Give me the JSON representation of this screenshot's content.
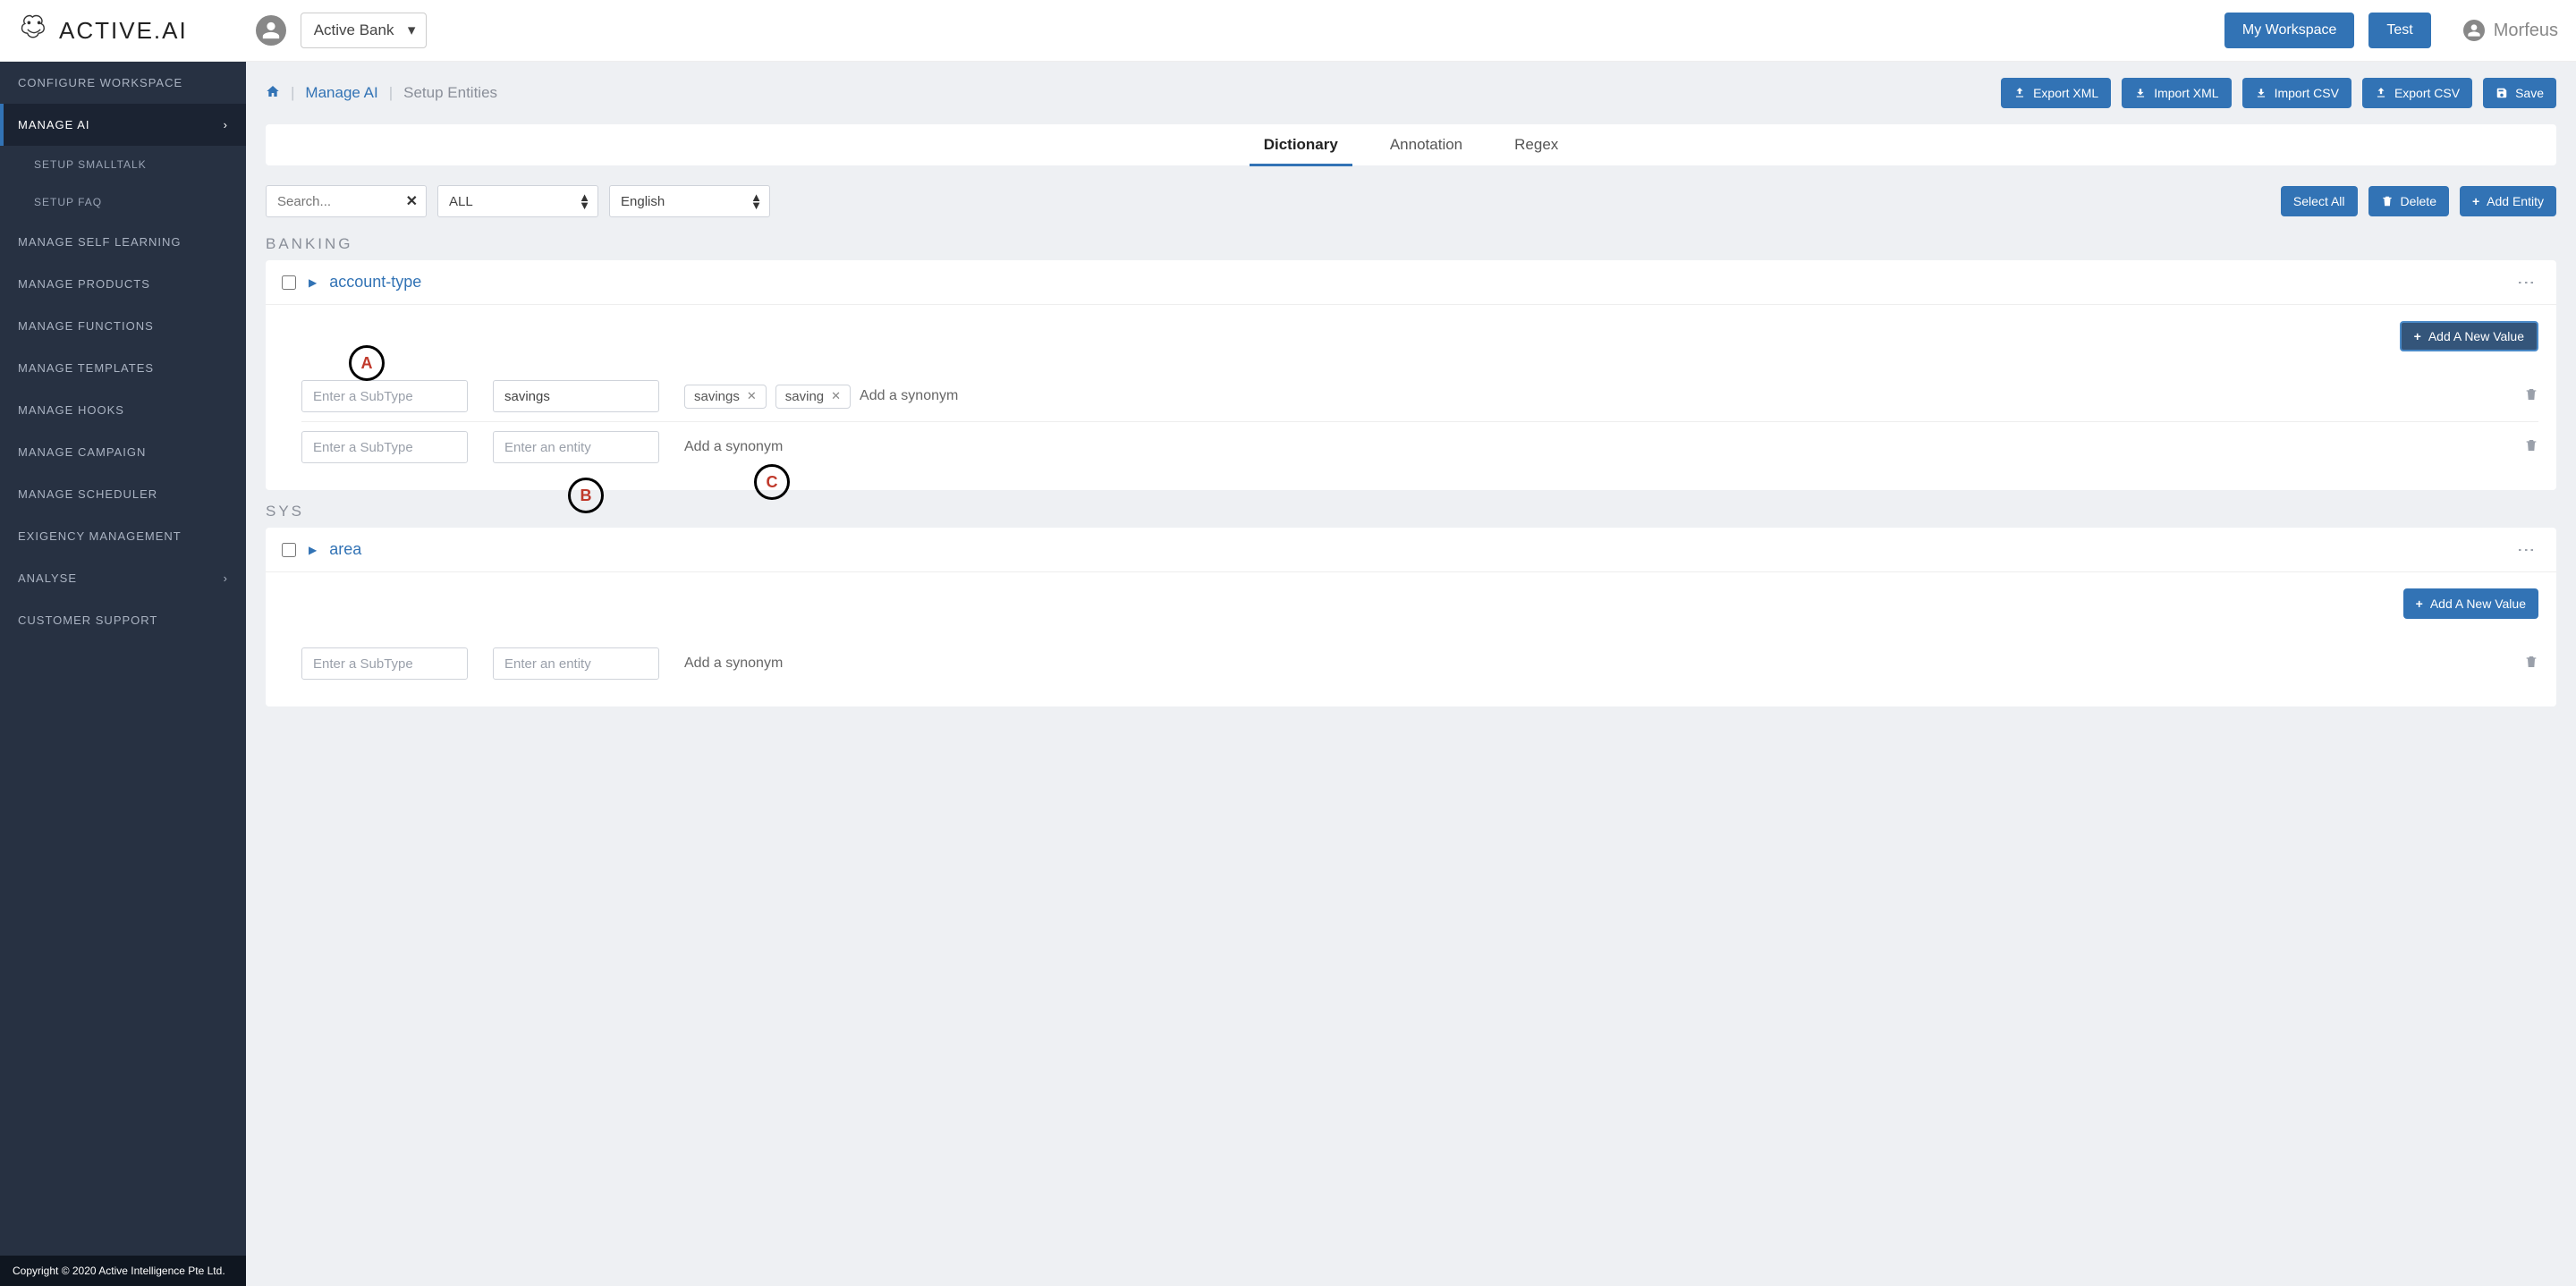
{
  "brand": "ACTIVE.AI",
  "workspace_selected": "Active Bank",
  "topbar": {
    "my_workspace": "My Workspace",
    "test": "Test",
    "username": "Morfeus"
  },
  "sidebar": {
    "items": [
      {
        "label": "Configure Workspace"
      },
      {
        "label": "Manage AI",
        "active": true
      },
      {
        "label": "Manage Self Learning"
      },
      {
        "label": "Manage Products"
      },
      {
        "label": "Manage Functions"
      },
      {
        "label": "Manage Templates"
      },
      {
        "label": "Manage Hooks"
      },
      {
        "label": "Manage Campaign"
      },
      {
        "label": "Manage Scheduler"
      },
      {
        "label": "Exigency Management"
      },
      {
        "label": "Analyse"
      },
      {
        "label": "Customer Support"
      }
    ],
    "subitems": [
      {
        "label": "Setup Smalltalk"
      },
      {
        "label": "Setup FAQ"
      }
    ],
    "footer": "Copyright © 2020 Active Intelligence Pte Ltd."
  },
  "breadcrumb": {
    "link": "Manage AI",
    "current": "Setup Entities"
  },
  "action_buttons": {
    "export_xml": "Export XML",
    "import_xml": "Import XML",
    "import_csv": "Import CSV",
    "export_csv": "Export CSV",
    "save": "Save"
  },
  "tabs": [
    {
      "label": "Dictionary",
      "active": true
    },
    {
      "label": "Annotation"
    },
    {
      "label": "Regex"
    }
  ],
  "filters": {
    "search_placeholder": "Search...",
    "category": "ALL",
    "language": "English",
    "select_all": "Select All",
    "delete": "Delete",
    "add_entity": "Add Entity"
  },
  "sections": [
    {
      "label": "Banking",
      "entities": [
        {
          "name": "account-type",
          "add_value_label": "Add A New Value",
          "rows": [
            {
              "subtype_placeholder": "Enter a SubType",
              "entity_value": "savings",
              "entity_placeholder": "Enter an entity",
              "synonyms": [
                "savings",
                "saving"
              ],
              "syn_placeholder": "Add a synonym"
            },
            {
              "subtype_placeholder": "Enter a SubType",
              "entity_value": "",
              "entity_placeholder": "Enter an entity",
              "synonyms": [],
              "syn_placeholder": "Add a synonym"
            }
          ]
        }
      ]
    },
    {
      "label": "Sys",
      "entities": [
        {
          "name": "area",
          "add_value_label": "Add A New Value",
          "rows": [
            {
              "subtype_placeholder": "Enter a SubType",
              "entity_value": "",
              "entity_placeholder": "Enter an entity",
              "synonyms": [],
              "syn_placeholder": "Add a synonym"
            }
          ]
        }
      ]
    }
  ],
  "callouts": {
    "a": "A",
    "b": "B",
    "c": "C"
  }
}
